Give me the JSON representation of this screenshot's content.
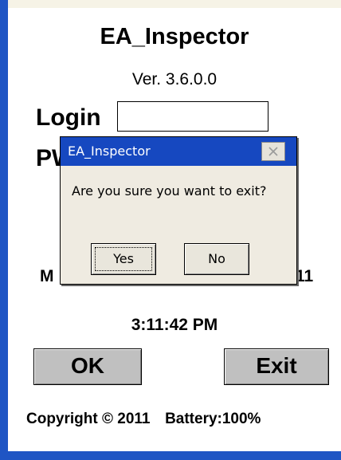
{
  "app": {
    "title": "EA_Inspector",
    "version": "Ver. 3.6.0.0"
  },
  "login": {
    "label": "Login",
    "value": ""
  },
  "password": {
    "label_visible": "PW"
  },
  "date": {
    "left_fragment": "M",
    "right_fragment": "11"
  },
  "time": "3:11:42 PM",
  "buttons": {
    "ok": "OK",
    "exit": "Exit"
  },
  "footer": {
    "copyright": "Copyright © 2011",
    "battery": "Battery:100%"
  },
  "dialog": {
    "title": "EA_Inspector",
    "message": "Are you sure you want to exit?",
    "yes_label": "Yes",
    "no_label": "No",
    "close_icon": "close-icon"
  },
  "colors": {
    "window_border": "#1f55c4",
    "dialog_titlebar": "#1648c0",
    "button_face": "#c0c0c0",
    "dialog_face": "#efebe1"
  }
}
